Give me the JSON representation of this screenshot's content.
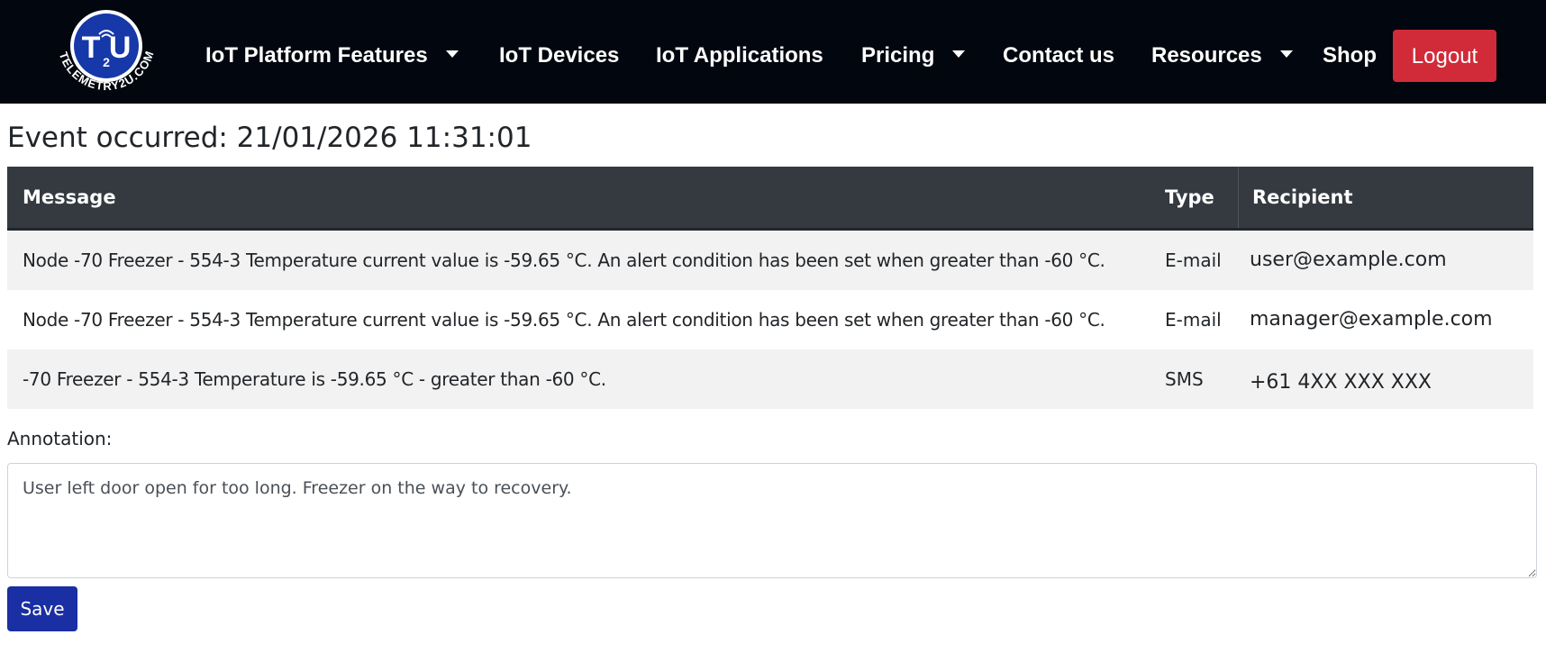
{
  "brand": {
    "logo_main": "T U",
    "logo_sub": "2",
    "logo_ring_text": "TELEMETRY2U.COM"
  },
  "nav": {
    "items": [
      {
        "label": "IoT Platform Features",
        "dropdown": true
      },
      {
        "label": "IoT Devices",
        "dropdown": false
      },
      {
        "label": "IoT Applications",
        "dropdown": false
      },
      {
        "label": "Pricing",
        "dropdown": true
      },
      {
        "label": "Contact us",
        "dropdown": false
      },
      {
        "label": "Resources",
        "dropdown": true
      },
      {
        "label": "Shop",
        "dropdown": false
      }
    ],
    "logout_label": "Logout"
  },
  "page": {
    "title": "Event occurred: 21/01/2026 11:31:01"
  },
  "table": {
    "headers": {
      "message": "Message",
      "type": "Type",
      "recipient": "Recipient"
    },
    "rows": [
      {
        "message": "Node -70 Freezer - 554-3 Temperature current value is -59.65 °C. An alert condition has been set when greater than -60 °C.",
        "type": "E-mail",
        "recipient": "user@example.com"
      },
      {
        "message": "Node -70 Freezer - 554-3 Temperature current value is -59.65 °C. An alert condition has been set when greater than -60 °C.",
        "type": "E-mail",
        "recipient": "manager@example.com"
      },
      {
        "message": "-70 Freezer - 554-3 Temperature is -59.65 °C - greater than -60 °C.",
        "type": "SMS",
        "recipient": "+61 4XX XXX XXX"
      }
    ]
  },
  "annotation": {
    "label": "Annotation:",
    "value": "User left door open for too long. Freezer on the way to recovery."
  },
  "actions": {
    "save_label": "Save"
  },
  "colors": {
    "navbar_bg": "#02060e",
    "logout_bg": "#d12b3a",
    "save_bg": "#1a2fa3",
    "table_header_bg": "#343a40",
    "row_stripe": "#f2f2f2",
    "logo_blue": "#1638a8"
  }
}
